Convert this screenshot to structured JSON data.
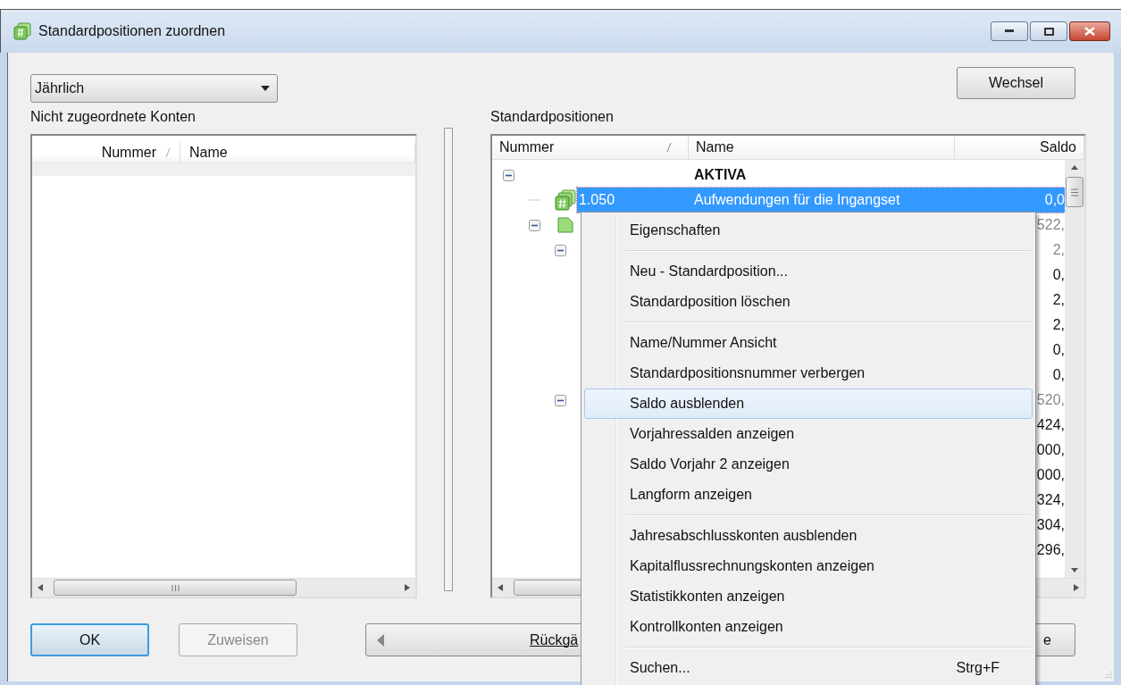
{
  "window": {
    "title": "Standardpositionen zuordnen"
  },
  "period_dropdown": {
    "value": "Jährlich"
  },
  "switch_button": "Wechsel",
  "left_panel": {
    "title": "Nicht zugeordnete Konten",
    "columns": [
      "Nummer",
      "Name"
    ]
  },
  "right_panel": {
    "title": "Standardpositionen",
    "columns": [
      "Nummer",
      "Name",
      "Saldo"
    ],
    "tree": [
      {
        "kind": "root",
        "name": "AKTIVA",
        "expanded": true,
        "children": [
          {
            "kind": "position",
            "number": "1.050",
            "name": "Aufwendungen für die Ingangset",
            "saldo": "0,0",
            "selected": true
          },
          {
            "kind": "group",
            "saldo": "522,",
            "selected": false,
            "expanded": true,
            "children": [
              {
                "kind": "group",
                "saldo": "2,",
                "selected": false,
                "expanded": true,
                "children": [
                  {
                    "kind": "position",
                    "saldo": "0,",
                    "selected": false
                  },
                  {
                    "kind": "position",
                    "saldo": "2,",
                    "selected": false
                  },
                  {
                    "kind": "position",
                    "saldo": "2,",
                    "selected": false
                  },
                  {
                    "kind": "position",
                    "saldo": "0,",
                    "selected": false
                  },
                  {
                    "kind": "position",
                    "saldo": "0,",
                    "selected": false
                  }
                ]
              },
              {
                "kind": "group",
                "saldo": "520,",
                "selected": false,
                "expanded": true,
                "children": [
                  {
                    "kind": "position",
                    "saldo": "424,",
                    "selected": false
                  },
                  {
                    "kind": "position",
                    "saldo": "000,",
                    "selected": false
                  },
                  {
                    "kind": "position",
                    "saldo": "000,",
                    "selected": false
                  },
                  {
                    "kind": "position",
                    "saldo": "324,",
                    "selected": false
                  },
                  {
                    "kind": "position",
                    "saldo": "304,",
                    "selected": false
                  },
                  {
                    "kind": "position",
                    "saldo": "296,",
                    "selected": false
                  }
                ]
              }
            ]
          }
        ]
      }
    ]
  },
  "context_menu": {
    "groups": [
      [
        {
          "label": "Eigenschaften",
          "selected": false
        }
      ],
      [
        {
          "label": "Neu - Standardposition...",
          "selected": false
        },
        {
          "label": "Standardposition löschen",
          "selected": false
        }
      ],
      [
        {
          "label": "Name/Nummer Ansicht",
          "selected": false
        },
        {
          "label": "Standardpositionsnummer verbergen",
          "selected": false
        },
        {
          "label": "Saldo ausblenden",
          "selected": true
        },
        {
          "label": "Vorjahressalden anzeigen",
          "selected": false
        },
        {
          "label": "Saldo Vorjahr 2 anzeigen",
          "selected": false
        },
        {
          "label": "Langform anzeigen",
          "selected": false
        }
      ],
      [
        {
          "label": "Jahresabschlusskonten ausblenden",
          "selected": false
        },
        {
          "label": "Kapitalflussrechnungskonten anzeigen",
          "selected": false
        },
        {
          "label": "Statistikkonten anzeigen",
          "selected": false
        },
        {
          "label": "Kontrollkonten anzeigen",
          "selected": false
        }
      ],
      [
        {
          "label": "Suchen...",
          "shortcut": "Strg+F",
          "selected": false
        }
      ]
    ]
  },
  "buttons": [
    {
      "kind": "ok",
      "label": "OK",
      "disabled": false
    },
    {
      "kind": "assign",
      "label": "Zuweisen",
      "disabled": true
    },
    {
      "kind": "undo",
      "label": "Rückgä",
      "disabled": false
    },
    {
      "kind": "last",
      "label": "e",
      "disabled": false
    }
  ]
}
